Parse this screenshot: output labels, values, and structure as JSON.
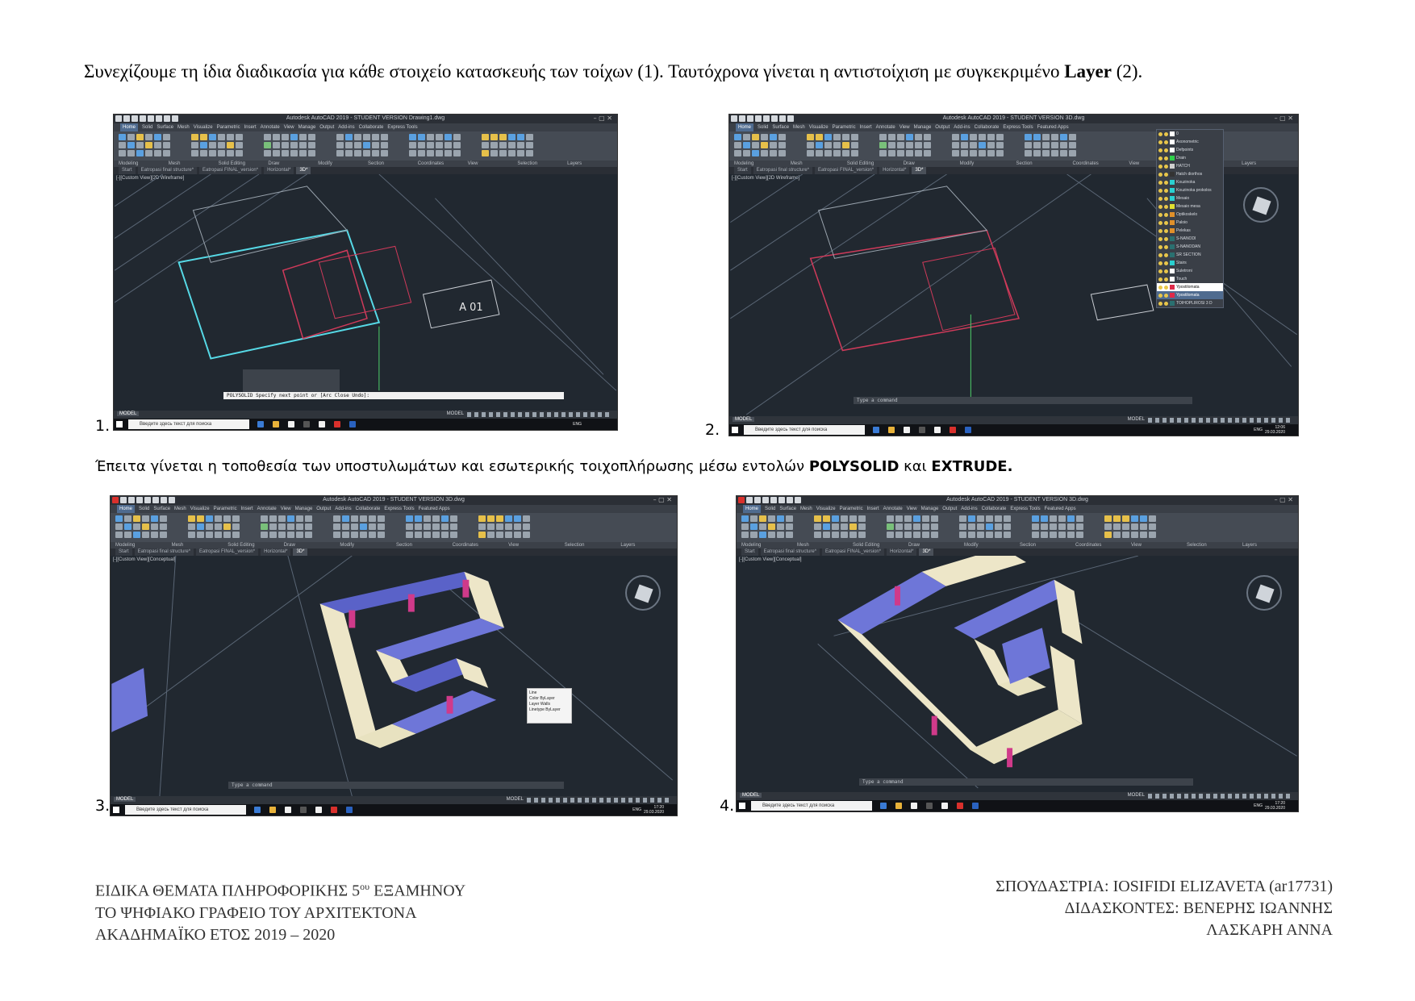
{
  "intro": {
    "text_a": "Συνεχίζουμε τη ίδια διαδικασία για κάθε στοιχείο κατασκευής των τοίχων (1). Ταυτόχρονα γίνεται η αντιστοίχιση με συγκεκριμένο ",
    "bold": "Layer",
    "text_b": " (2)."
  },
  "step2": {
    "text_a": "Έπειτα γίνεται η τοποθεσία των υποστυλωμάτων και εσωτερικής τοιχοπλήρωσης μέσω εντολών ",
    "bold_1": "POLYSOLID",
    "text_b": " και ",
    "bold_2": "EXTRUDE."
  },
  "screenshots": [
    {
      "number": "1.",
      "title": "Autodesk AutoCAD 2019 - STUDENT VERSION    Drawing1.dwg",
      "viewport_label": "[-][Custom View][2D Wireframe]",
      "command": "POLYSOLID Specify next point or [Arc Close Undo]:",
      "status": "MODEL"
    },
    {
      "number": "2.",
      "title": "Autodesk AutoCAD 2019 - STUDENT VERSION    3D.dwg",
      "viewport_label": "[-][Custom View][2D Wireframe]",
      "command": "Type a command",
      "status": "MODEL",
      "clock": "12:06",
      "date": "29.03.2020"
    },
    {
      "number": "3.",
      "title": "Autodesk AutoCAD 2019 - STUDENT VERSION    3D.dwg",
      "viewport_label": "[-][Custom View][Conceptual]",
      "command": "Type a command",
      "status": "MODEL",
      "clock": "17:20",
      "date": "29.03.2020"
    },
    {
      "number": "4.",
      "title": "Autodesk AutoCAD 2019 - STUDENT VERSION    3D.dwg",
      "viewport_label": "[-][Custom View][Conceptual]",
      "command": "Type a command",
      "status": "MODEL",
      "clock": "17:20",
      "date": "29.03.2020"
    }
  ],
  "ribbon_tabs": [
    "Home",
    "Solid",
    "Surface",
    "Mesh",
    "Visualize",
    "Parametric",
    "Insert",
    "Annotate",
    "View",
    "Manage",
    "Output",
    "Add-ins",
    "Collaborate",
    "Express Tools",
    "Featured Apps"
  ],
  "ribbon_panels": [
    "Modeling",
    "Mesh",
    "Solid Editing",
    "Draw",
    "Modify",
    "Section",
    "Coordinates",
    "View",
    "Selection",
    "Layers"
  ],
  "file_tabs": [
    "Start",
    "Eatropasi final structure*",
    "Eatropasi FINAL_version*",
    "Horizontal*",
    "3D*"
  ],
  "taskbar": {
    "search_placeholder": "Введите здесь текст для поиска",
    "lang": "ENG"
  },
  "layers_dropdown": [
    {
      "name": "0",
      "color": "#ffffff"
    },
    {
      "name": "Axonometric",
      "color": "#ffffff"
    },
    {
      "name": "Defpoints",
      "color": "#ffffff"
    },
    {
      "name": "Drain",
      "color": "#2fd04a"
    },
    {
      "name": "HATCH",
      "color": "#cfcfcf"
    },
    {
      "name": "Hatch diorthos",
      "color": "#333333"
    },
    {
      "name": "Kouzinoka",
      "color": "#2ad0d0"
    },
    {
      "name": "Kouzinoka prokolos",
      "color": "#2ad0d0"
    },
    {
      "name": "Mesaio",
      "color": "#2ad0d0"
    },
    {
      "name": "Mesaio mesa",
      "color": "#e0e030"
    },
    {
      "name": "Optikoskelo",
      "color": "#e0902a"
    },
    {
      "name": "Paloio",
      "color": "#e0902a"
    },
    {
      "name": "Pelekas",
      "color": "#e0902a"
    },
    {
      "name": "S-NANODI",
      "color": "#2a7070"
    },
    {
      "name": "S-NANODAN",
      "color": "#2a7070"
    },
    {
      "name": "SR SECTION",
      "color": "#2a7070"
    },
    {
      "name": "Stairs",
      "color": "#2ad0d0"
    },
    {
      "name": "Suletroni",
      "color": "#ffffff"
    },
    {
      "name": "Touch",
      "color": "#ffffff"
    },
    {
      "name": "Ypostilomata",
      "color": "#e02a4a",
      "selected": true
    },
    {
      "name": "Ypostilomata",
      "color": "#e02a4a",
      "highlight": true
    },
    {
      "name": "TOIHOPLIROSI 3 D",
      "color": "#2a7070"
    }
  ],
  "properties_popup": {
    "title": "Line",
    "rows": [
      {
        "label": "Color",
        "value": "ByLayer"
      },
      {
        "label": "Layer",
        "value": "Walls"
      },
      {
        "label": "Linetype",
        "value": "ByLayer"
      }
    ]
  },
  "a01_label": "A 01",
  "footer_left": {
    "line1_a": "ΕΙΔΙΚΑ ΘΕΜΑΤΑ ΠΛΗΡΟΦΟΡΙΚΗΣ 5",
    "line1_sup": "ου",
    "line1_b": " ΕΞΑΜΗΝΟΥ",
    "line2": "ΤΟ ΨΗΦΙΑΚΟ ΓΡΑΦΕΙΟ ΤΟΥ ΑΡΧΙΤΕΚΤΟΝΑ",
    "line3": "ΑΚΑΔΗΜΑΪΚΟ ΕΤΟΣ 2019 – 2020"
  },
  "footer_right": {
    "line1": "ΣΠΟΥΔΑΣΤΡΙΑ: IOSIFIDI ELIZAVETA (ar17731)",
    "line2": "ΔΙΔΑΣΚΟΝΤΕΣ: ΒΕΝΕΡΗΣ ΙΩΑΝΝΗΣ",
    "line3": "ΛΑΣΚΑΡΗ ΑΝΝΑ"
  }
}
